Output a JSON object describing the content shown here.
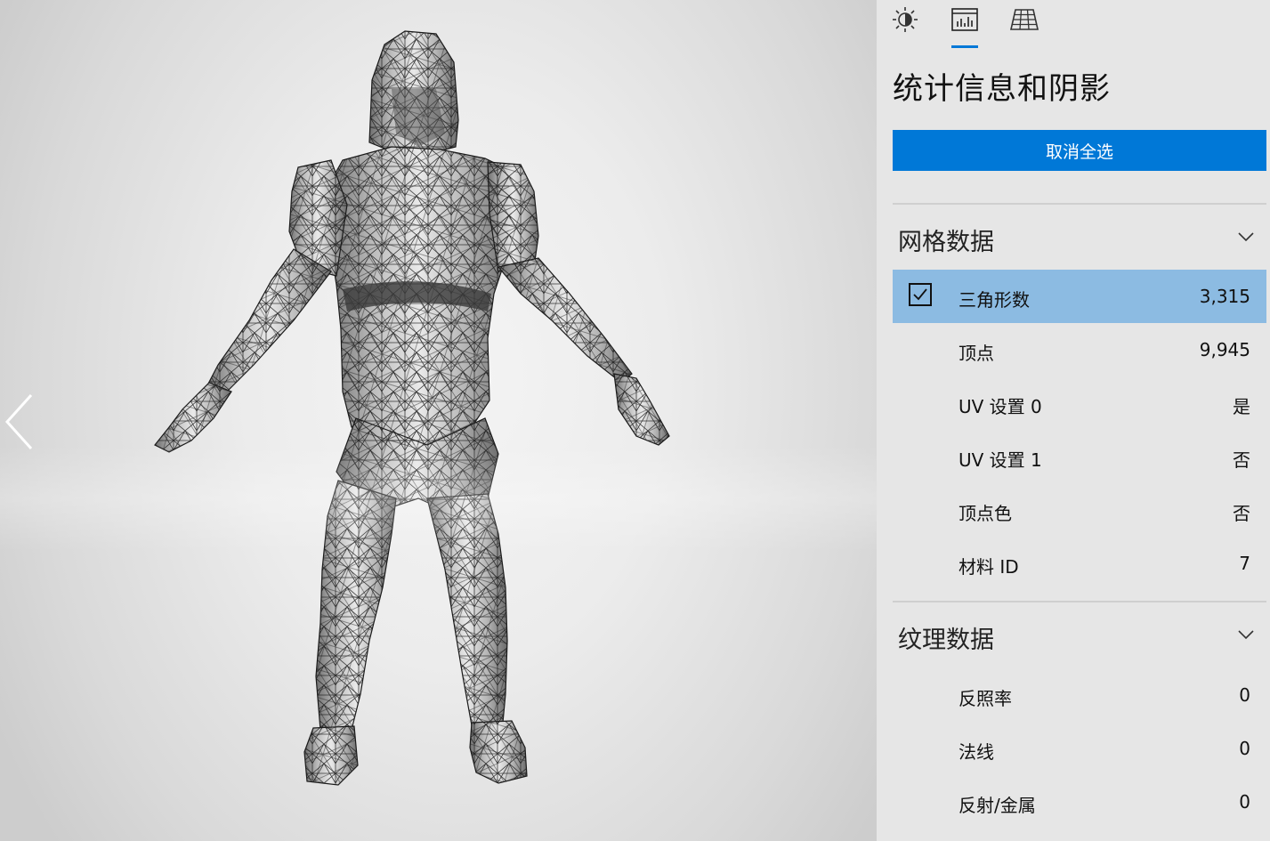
{
  "tabs": [
    {
      "icon": "lighting-icon",
      "selected": false
    },
    {
      "icon": "stats-icon",
      "selected": true
    },
    {
      "icon": "grid-icon",
      "selected": false
    }
  ],
  "panel": {
    "title": "统计信息和阴影",
    "deselect_all_label": "取消全选",
    "accent_color": "#0078d7",
    "selected_row_color": "#8cbbe2"
  },
  "mesh_section": {
    "title": "网格数据",
    "rows": [
      {
        "label": "三角形数",
        "value": "3,315",
        "checked": true
      },
      {
        "label": "顶点",
        "value": "9,945"
      },
      {
        "label": "UV 设置 0",
        "value": "是"
      },
      {
        "label": "UV 设置 1",
        "value": "否"
      },
      {
        "label": "顶点色",
        "value": "否"
      },
      {
        "label": "材料 ID",
        "value": "7"
      }
    ]
  },
  "texture_section": {
    "title": "纹理数据",
    "rows": [
      {
        "label": "反照率",
        "value": "0"
      },
      {
        "label": "法线",
        "value": "0"
      },
      {
        "label": "反射/金属",
        "value": "0"
      }
    ]
  },
  "viewport": {
    "back_icon": "chevron-left-icon",
    "model": "wireframe-humanoid-model"
  }
}
